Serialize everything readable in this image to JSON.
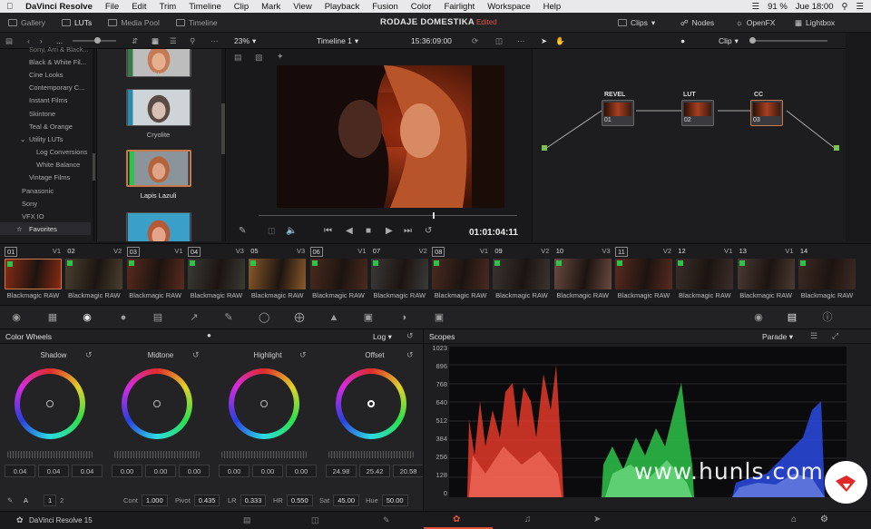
{
  "macmenu": {
    "apple": "",
    "app": "DaVinci Resolve",
    "items": [
      "File",
      "Edit",
      "Trim",
      "Timeline",
      "Clip",
      "Mark",
      "View",
      "Playback",
      "Fusion",
      "Color",
      "Fairlight",
      "Workspace",
      "Help"
    ],
    "battery": "91 %",
    "clock": "Jue 18:00"
  },
  "pagebar": {
    "tabs": [
      "Gallery",
      "LUTs",
      "Media Pool",
      "Timeline"
    ],
    "project": "RODAJE DOMESTIKA",
    "status": "Edited",
    "right_tabs": [
      "Clips",
      "Nodes",
      "OpenFX",
      "Lightbox"
    ]
  },
  "toolbar": {
    "breadcrumb": "...",
    "zoom": "23%",
    "timeline": "Timeline 1",
    "timecode": "15:36:09:00",
    "mode": "Clip"
  },
  "lutlist": {
    "items": [
      "Black & White Fil...",
      "Cine Looks",
      "Contemporary C...",
      "Instant Films",
      "Skintone",
      "Teal & Orange",
      "Utility LUTs",
      "Log Conversions",
      "White Balance",
      "Vintage Films",
      "Panasonic",
      "Sony",
      "VFX IO",
      "Favorites"
    ],
    "top_cut": "Sony, Arri & Black..."
  },
  "luts": {
    "thumbs": [
      "Richterite",
      "Cryolite",
      "Lapis Lazuli"
    ]
  },
  "viewer": {
    "timecode": "01:01:04:11"
  },
  "nodes": [
    {
      "label": "REVEL",
      "num": "01"
    },
    {
      "label": "LUT",
      "num": "02"
    },
    {
      "label": "CC",
      "num": "03"
    }
  ],
  "clips": [
    {
      "n": "01",
      "v": "V1",
      "label": "Blackmagic RAW",
      "sel": true
    },
    {
      "n": "02",
      "v": "V2",
      "label": "Blackmagic RAW"
    },
    {
      "n": "03",
      "v": "V1",
      "label": "Blackmagic RAW",
      "sel": true
    },
    {
      "n": "04",
      "v": "V3",
      "label": "Blackmagic RAW",
      "sel": true
    },
    {
      "n": "05",
      "v": "V3",
      "label": "Blackmagic RAW"
    },
    {
      "n": "06",
      "v": "V1",
      "label": "Blackmagic RAW",
      "sel": true
    },
    {
      "n": "07",
      "v": "V2",
      "label": "Blackmagic RAW"
    },
    {
      "n": "08",
      "v": "V1",
      "label": "Blackmagic RAW",
      "sel": true
    },
    {
      "n": "09",
      "v": "V2",
      "label": "Blackmagic RAW"
    },
    {
      "n": "10",
      "v": "V3",
      "label": "Blackmagic RAW"
    },
    {
      "n": "11",
      "v": "V2",
      "label": "Blackmagic RAW",
      "sel": true
    },
    {
      "n": "12",
      "v": "V1",
      "label": "Blackmagic RAW"
    },
    {
      "n": "13",
      "v": "V1",
      "label": "Blackmagic RAW"
    },
    {
      "n": "14",
      "v": "",
      "label": "Blackmagic RAW"
    }
  ],
  "colorwheels": {
    "title": "Color Wheels",
    "mode": "Log",
    "wheels": [
      {
        "name": "Shadow",
        "vals": [
          "0.04",
          "0.04",
          "0.04"
        ]
      },
      {
        "name": "Midtone",
        "vals": [
          "0.00",
          "0.00",
          "0.00"
        ]
      },
      {
        "name": "Highlight",
        "vals": [
          "0.00",
          "0.00",
          "0.00"
        ]
      },
      {
        "name": "Offset",
        "vals": [
          "24.98",
          "25.42",
          "20.58"
        ]
      }
    ],
    "footer": {
      "page1": "1",
      "page2": "2",
      "cont_label": "Cont",
      "cont": "1.000",
      "pivot_label": "Pivot",
      "pivot": "0.435",
      "lr_label": "LR",
      "lr": "0.333",
      "hr_label": "HR",
      "hr": "0.550",
      "sat_label": "Sat",
      "sat": "45.00",
      "hue_label": "Hue",
      "hue": "50.00"
    }
  },
  "scopes": {
    "title": "Scopes",
    "mode": "Parade",
    "yticks": [
      "1023",
      "896",
      "768",
      "640",
      "512",
      "384",
      "256",
      "128",
      "0"
    ]
  },
  "status": {
    "app": "DaVinci Resolve 15"
  },
  "watermark": "www.hunls.com",
  "colors": {
    "accent": "#e0503a",
    "selected": "#c97a4a",
    "green": "#2ec24a"
  }
}
